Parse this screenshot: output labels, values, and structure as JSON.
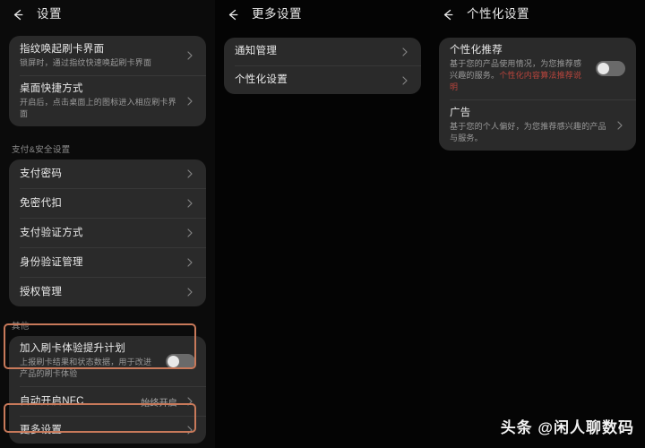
{
  "meta": {
    "accent_orange": "#c8795a",
    "card_bg": "#2a2a2a",
    "page_bg": "#000000",
    "red_link": "#b8443c"
  },
  "panel_left": {
    "header": {
      "title": "设置",
      "back_icon": "back-arrow-icon"
    },
    "group_top": [
      {
        "title": "指纹唤起刷卡界面",
        "subtitle": "锁屏时，通过指纹快速唤起刷卡界面",
        "accessory": "chevron"
      },
      {
        "title": "桌面快捷方式",
        "subtitle": "开启后，点击桌面上的图标进入相应刷卡界面",
        "accessory": "chevron"
      }
    ],
    "section_pay_label": "支付&安全设置",
    "group_pay": [
      {
        "title": "支付密码",
        "accessory": "chevron"
      },
      {
        "title": "免密代扣",
        "accessory": "chevron"
      },
      {
        "title": "支付验证方式",
        "accessory": "chevron"
      },
      {
        "title": "身份验证管理",
        "accessory": "chevron"
      },
      {
        "title": "授权管理",
        "accessory": "chevron"
      }
    ],
    "section_other_label": "其他",
    "group_other": [
      {
        "title": "加入刷卡体验提升计划",
        "subtitle": "上报刷卡结果和状态数据，用于改进产品的刷卡体验",
        "accessory": "toggle",
        "toggle_on": false,
        "highlighted": true
      },
      {
        "title": "自动开启NFC",
        "value": "始终开启",
        "accessory": "chevron",
        "highlighted": false
      },
      {
        "title": "更多设置",
        "accessory": "chevron",
        "highlighted": true
      }
    ]
  },
  "panel_middle": {
    "header": {
      "title": "更多设置",
      "back_icon": "back-arrow-icon"
    },
    "group": [
      {
        "title": "通知管理",
        "accessory": "chevron"
      },
      {
        "title": "个性化设置",
        "accessory": "chevron"
      }
    ]
  },
  "panel_right": {
    "header": {
      "title": "个性化设置",
      "back_icon": "back-arrow-icon"
    },
    "group": [
      {
        "title": "个性化推荐",
        "subtitle_plain": "基于您的产品使用情况，为您推荐感兴趣的服务。",
        "subtitle_link": "个性化内容算法推荐说明",
        "accessory": "toggle",
        "toggle_on": false
      },
      {
        "title": "广告",
        "subtitle": "基于您的个人偏好，为您推荐感兴趣的产品与服务。",
        "accessory": "chevron"
      }
    ]
  },
  "watermark": {
    "text": "头条 @闲人聊数码"
  }
}
